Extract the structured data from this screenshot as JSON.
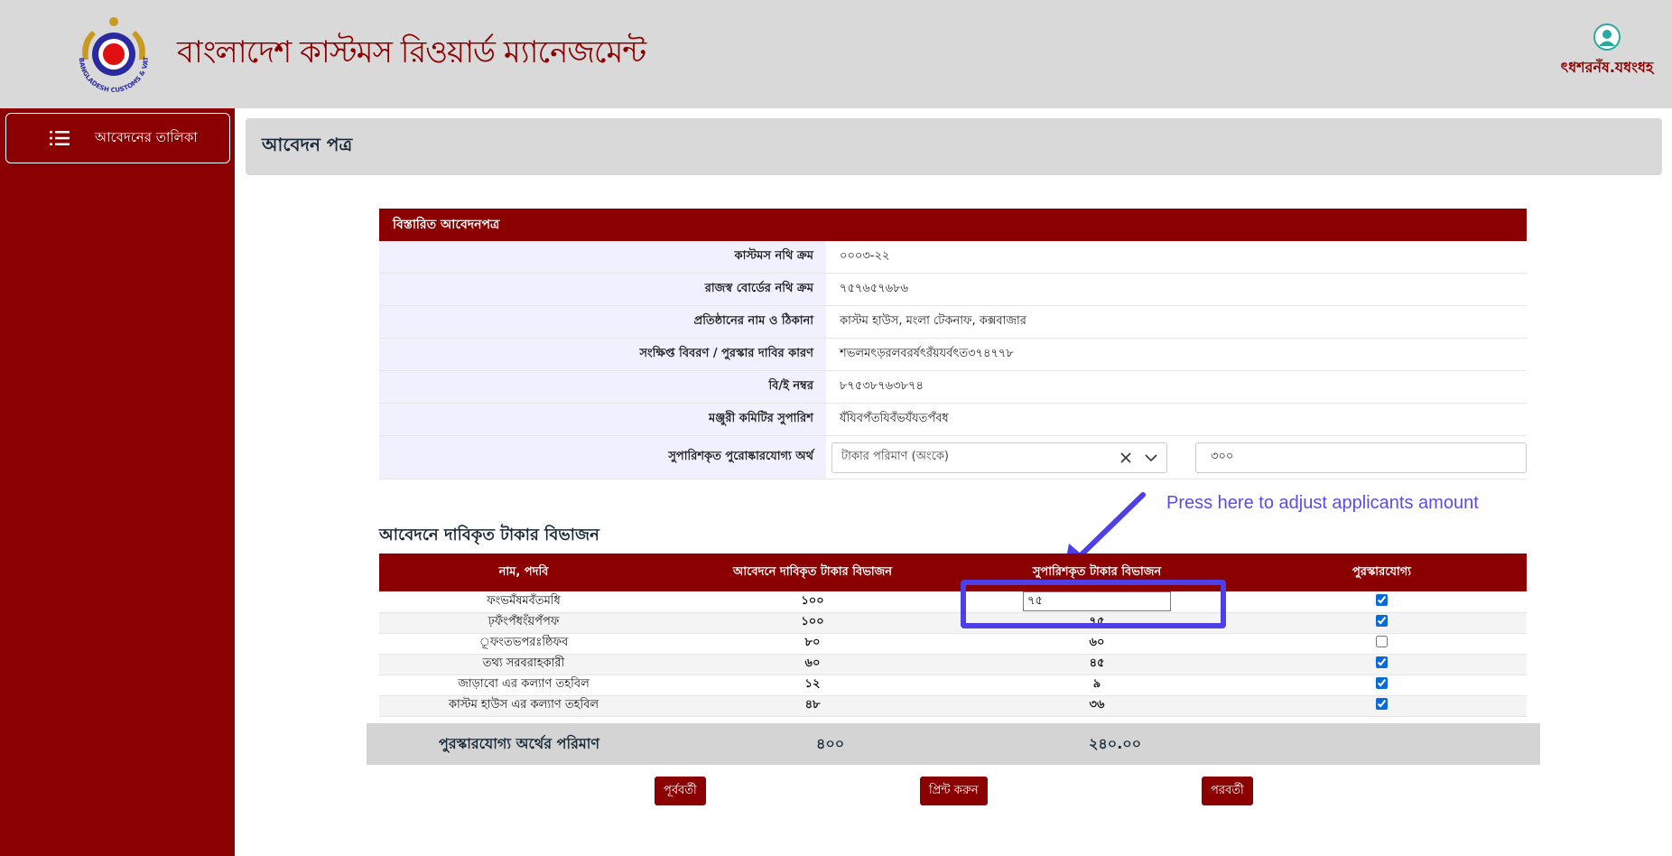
{
  "header": {
    "app_title": "বাংলাদেশ কাস্টমস রিওয়ার্ড ম্যানেজমেন্ট",
    "logo_text": "BANGLADESH CUSTOMS & VAT",
    "user_name": "ৎধশরনঁষ.যধংধহ"
  },
  "sidebar": {
    "items": [
      {
        "label": "আবেদনের তালিকা",
        "icon": "list-icon"
      }
    ]
  },
  "page": {
    "title": "আবেদন পত্র"
  },
  "details": {
    "heading": "বিস্তারিত আবেদনপত্র",
    "rows": [
      {
        "label": "কাস্টমস নথি ক্রম",
        "value": "০০০৩-২২"
      },
      {
        "label": "রাজস্ব বোর্ডের নথি ক্রম",
        "value": "৭৫৭৬৫৭৬৮৬"
      },
      {
        "label": "প্রতিষ্ঠানের নাম ও ঠিকানা",
        "value": "কাস্টম হাউস, মংলা টেকনাফ, কক্সবাজার"
      },
      {
        "label": "সংক্ষিপ্ত বিবরণ / পুরস্কার দাবির কারণ",
        "value": "শভলমৎড়রলবরর্ষৎরঁয়যর্বৎত৩৭৪৭৭৮"
      },
      {
        "label": "বি/ই নম্বর",
        "value": "৮৭৫৩৮৭৬৩৮৭৪"
      },
      {
        "label": "মঞ্জুরী কমিটির সুপারিশ",
        "value": "যঁযিবপঁতযিবঁভযঁযতপঁবধ"
      }
    ],
    "reward": {
      "label": "সুপারিশকৃত পুরোষ্কারযোগ্য অর্থ",
      "select_value": "টাকার পরিমাণ (অংকে)",
      "amount": "৩০০"
    }
  },
  "annotation": {
    "text": "Press here to adjust applicants amount"
  },
  "allocation": {
    "title": "আবেদনে দাবিকৃত টাকার বিভাজন",
    "headers": [
      "নাম, পদবি",
      "আবেদনে দাবিকৃত টাকার বিভাজন",
      "সুপারিশকৃত টাকার বিভাজন",
      "পুরস্কারযোগ্য"
    ],
    "rows": [
      {
        "name": "ফংভমঁষমবঁতমধি",
        "claimed": "১০০",
        "recommended": "৭৫",
        "eligible": true
      },
      {
        "name": "ঢ়ফঁংপঁধংঁয়পঁপফ",
        "claimed": "১০০",
        "recommended": "৭৫",
        "eligible": true
      },
      {
        "name": "ূফংতভপরঃষ্ঠিফব",
        "claimed": "৮০",
        "recommended": "৬০",
        "eligible": false
      },
      {
        "name": "তথ্য সরবরাহকারী",
        "claimed": "৬০",
        "recommended": "৪৫",
        "eligible": true
      },
      {
        "name": "জাড়াবো এর কল্যাণ তহবিল",
        "claimed": "১২",
        "recommended": "৯",
        "eligible": true
      },
      {
        "name": "কাস্টম হাউস এর কল্যাণ তহবিল",
        "claimed": "৪৮",
        "recommended": "৩৬",
        "eligible": true
      }
    ]
  },
  "totals": {
    "label": "পুরস্কারযোগ্য অর্থের পরিমাণ",
    "claimed": "৪০০",
    "recommended": "২৪০.০০"
  },
  "buttons": {
    "previous": "পূর্ববর্তী",
    "print": "প্রিন্ট করুন",
    "next": "পরবর্তী"
  },
  "colors": {
    "brand": "#8b0000",
    "header_bg": "#d9d9d9",
    "annotation": "#4f3fe6"
  }
}
